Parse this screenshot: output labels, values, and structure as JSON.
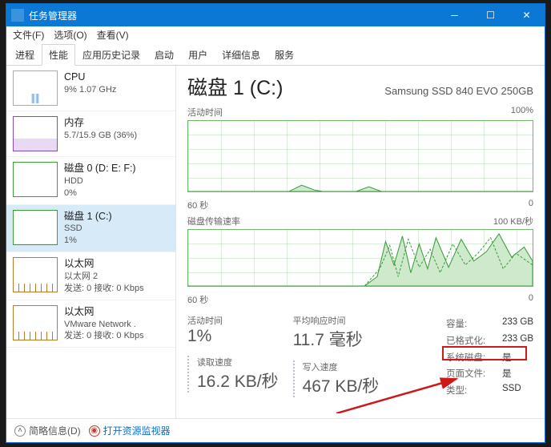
{
  "title": "任务管理器",
  "menus": [
    "文件(F)",
    "选项(O)",
    "查看(V)"
  ],
  "tabs": [
    "进程",
    "性能",
    "应用历史记录",
    "启动",
    "用户",
    "详细信息",
    "服务"
  ],
  "activeTab": 1,
  "sidebar": [
    {
      "name": "CPU",
      "line2": "9% 1.07 GHz"
    },
    {
      "name": "内存",
      "line2": "5.7/15.9 GB (36%)"
    },
    {
      "name": "磁盘 0 (D: E: F:)",
      "line2": "HDD",
      "line3": "0%"
    },
    {
      "name": "磁盘 1 (C:)",
      "line2": "SSD",
      "line3": "1%"
    },
    {
      "name": "以太网",
      "line2": "以太网 2",
      "line3": "发送: 0 接收: 0 Kbps"
    },
    {
      "name": "以太网",
      "line2": "VMware Network .",
      "line3": "发送: 0 接收: 0 Kbps"
    }
  ],
  "main": {
    "title": "磁盘 1 (C:)",
    "sub": "Samsung SSD 840 EVO 250GB",
    "chart1": {
      "label": "活动时间",
      "right": "100%",
      "foot": "60 秒",
      "footR": "0"
    },
    "chart2": {
      "label": "磁盘传输速率",
      "right": "100 KB/秒",
      "foot": "60 秒",
      "footR": "0"
    },
    "stats": {
      "s1": {
        "lbl": "活动时间",
        "val": "1%"
      },
      "s2": {
        "lbl": "平均响应时间",
        "val": "11.7 毫秒"
      },
      "s3": {
        "lbl": "读取速度",
        "val": "16.2 KB/秒"
      },
      "s4": {
        "lbl": "写入速度",
        "val": "467 KB/秒"
      }
    },
    "kv": [
      {
        "k": "容量:",
        "v": "233 GB"
      },
      {
        "k": "已格式化:",
        "v": "233 GB"
      },
      {
        "k": "系统磁盘:",
        "v": "是"
      },
      {
        "k": "页面文件:",
        "v": "是"
      },
      {
        "k": "类型:",
        "v": "SSD"
      }
    ]
  },
  "footer": {
    "collapse": "简略信息(D)",
    "link": "打开资源监视器"
  },
  "chart_data": [
    {
      "type": "area",
      "title": "活动时间",
      "ylim": [
        0,
        100
      ],
      "xlabel": "60 秒",
      "x": [
        0,
        5,
        10,
        15,
        20,
        25,
        30,
        35,
        40,
        45,
        50,
        55,
        60
      ],
      "values": [
        0,
        0,
        1,
        2,
        0,
        8,
        2,
        0,
        1,
        0,
        0,
        0,
        0
      ]
    },
    {
      "type": "area",
      "title": "磁盘传输速率",
      "ylim": [
        0,
        100
      ],
      "ylabel": "KB/秒",
      "xlabel": "60 秒",
      "x": [
        0,
        5,
        10,
        15,
        20,
        25,
        30,
        35,
        38,
        40,
        42,
        45,
        48,
        50,
        52,
        55,
        58,
        60
      ],
      "series": [
        {
          "name": "read",
          "values": [
            0,
            0,
            0,
            5,
            0,
            0,
            0,
            10,
            80,
            30,
            90,
            20,
            70,
            40,
            85,
            15,
            45,
            30
          ]
        },
        {
          "name": "write",
          "values": [
            0,
            0,
            2,
            8,
            3,
            0,
            4,
            15,
            60,
            95,
            50,
            85,
            25,
            75,
            35,
            90,
            65,
            55
          ]
        }
      ]
    }
  ]
}
